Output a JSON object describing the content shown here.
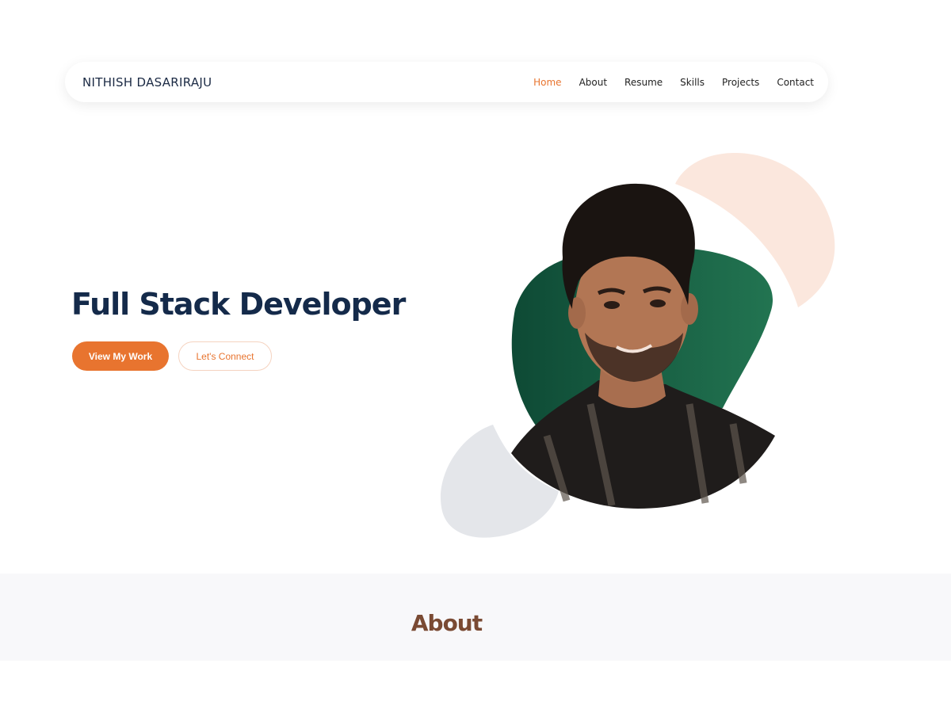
{
  "navbar": {
    "brand": "NITHISH DASARIRAJU",
    "links": [
      {
        "label": "Home",
        "active": true
      },
      {
        "label": "About",
        "active": false
      },
      {
        "label": "Resume",
        "active": false
      },
      {
        "label": "Skills",
        "active": false
      },
      {
        "label": "Projects",
        "active": false
      },
      {
        "label": "Contact",
        "active": false
      }
    ]
  },
  "hero": {
    "title": "Full Stack Developer",
    "primary_button": "View My Work",
    "secondary_button": "Let's Connect",
    "portrait_icon": "person-portrait-icon"
  },
  "about": {
    "title": "About"
  },
  "colors": {
    "accent": "#e8742f",
    "heading": "#142a4a",
    "green": "#1a6a4a",
    "peach": "#fbe7dd",
    "gray_blob": "#e4e6ea",
    "about_title": "#7a4a33"
  }
}
